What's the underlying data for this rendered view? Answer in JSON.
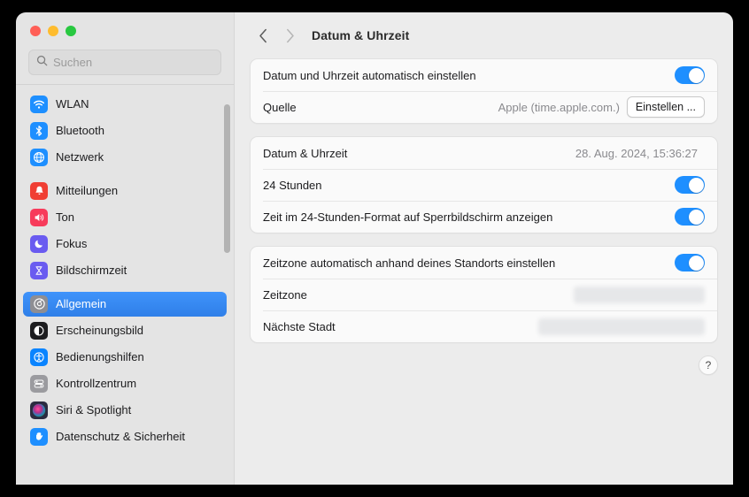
{
  "window": {
    "traffic_lights": [
      {
        "name": "close",
        "color": "#ff5f57"
      },
      {
        "name": "minimize",
        "color": "#febc2e"
      },
      {
        "name": "maximize",
        "color": "#28c840"
      }
    ]
  },
  "sidebar": {
    "search": {
      "placeholder": "Suchen",
      "value": "",
      "icon": "search-icon"
    },
    "groups": [
      {
        "items": [
          {
            "label": "WLAN",
            "icon": "wifi-icon",
            "icon_bg": "#1e8fff",
            "selected": false
          },
          {
            "label": "Bluetooth",
            "icon": "bluetooth-icon",
            "icon_bg": "#1e8fff",
            "selected": false
          },
          {
            "label": "Netzwerk",
            "icon": "globe-icon",
            "icon_bg": "#1e8fff",
            "selected": false
          }
        ]
      },
      {
        "items": [
          {
            "label": "Mitteilungen",
            "icon": "bell-icon",
            "icon_bg": "#f03e33",
            "selected": false
          },
          {
            "label": "Ton",
            "icon": "speaker-icon",
            "icon_bg": "#f73b5b",
            "selected": false
          },
          {
            "label": "Fokus",
            "icon": "moon-icon",
            "icon_bg": "#6a5bf0",
            "selected": false
          },
          {
            "label": "Bildschirmzeit",
            "icon": "hourglass-icon",
            "icon_bg": "#6a5bf0",
            "selected": false
          }
        ]
      },
      {
        "items": [
          {
            "label": "Allgemein",
            "icon": "gear-icon",
            "icon_bg": "#8e8e93",
            "selected": true
          },
          {
            "label": "Erscheinungsbild",
            "icon": "appearance-icon",
            "icon_bg": "#1c1c1e",
            "selected": false
          },
          {
            "label": "Bedienungshilfen",
            "icon": "accessibility-icon",
            "icon_bg": "#0a84ff",
            "selected": false
          },
          {
            "label": "Kontrollzentrum",
            "icon": "control-center-icon",
            "icon_bg": "#9b9b9f",
            "selected": false
          },
          {
            "label": "Siri & Spotlight",
            "icon": "siri-icon",
            "icon_bg": "#2b2b40",
            "selected": false
          },
          {
            "label": "Datenschutz & Sicherheit",
            "icon": "privacy-hand-icon",
            "icon_bg": "#1e8fff",
            "selected": false
          }
        ]
      }
    ]
  },
  "toolbar": {
    "back_icon": "chevron-left-icon",
    "forward_icon": "chevron-right-icon",
    "title": "Datum & Uhrzeit"
  },
  "sections": [
    {
      "name": "auto-datetime",
      "rows": [
        {
          "type": "toggle",
          "label": "Datum und Uhrzeit automatisch einstellen",
          "toggle_on": true
        },
        {
          "type": "value-button",
          "label": "Quelle",
          "value": "Apple (time.apple.com.)",
          "button_label": "Einstellen ..."
        }
      ]
    },
    {
      "name": "datetime-format",
      "rows": [
        {
          "type": "value",
          "label": "Datum & Uhrzeit",
          "value": "28. Aug. 2024, 15:36:27"
        },
        {
          "type": "toggle",
          "label": "24 Stunden",
          "toggle_on": true
        },
        {
          "type": "toggle",
          "label": "Zeit im 24-Stunden-Format auf Sperrbildschirm anzeigen",
          "toggle_on": true
        }
      ]
    },
    {
      "name": "timezone",
      "rows": [
        {
          "type": "toggle",
          "label": "Zeitzone automatisch anhand deines Standorts einstellen",
          "toggle_on": true
        },
        {
          "type": "skeleton",
          "label": "Zeitzone",
          "value": ""
        },
        {
          "type": "skeleton",
          "label": "Nächste Stadt",
          "value": ""
        }
      ]
    }
  ],
  "help": {
    "label": "?",
    "icon": "question-mark-icon"
  },
  "colors": {
    "accent": "#1e8fff",
    "selection": "#3f93fb",
    "sidebar_bg": "#e4e4e4",
    "panel_bg": "#ececec",
    "card_bg": "#fafafa",
    "secondary_text": "#8a8a8e"
  }
}
